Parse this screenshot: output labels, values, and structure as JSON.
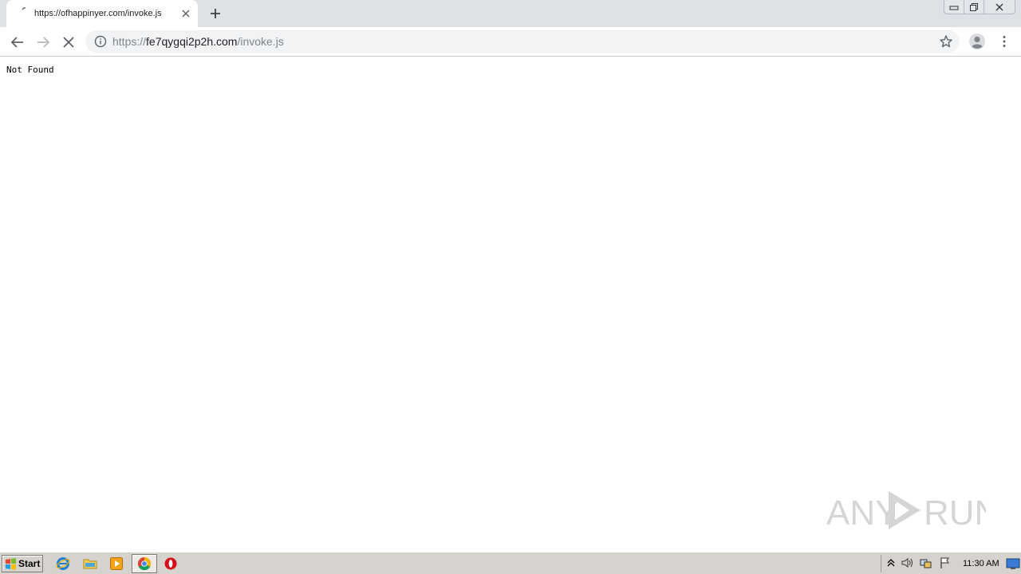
{
  "browser": {
    "tab": {
      "title": "https://ofhappinyer.com/invoke.js"
    },
    "address": {
      "scheme": "https://",
      "host": "fe7qygqi2p2h.com",
      "path": "/invoke.js"
    },
    "accent_color": "#1a73e8"
  },
  "page": {
    "body_text": "Not Found"
  },
  "watermark": {
    "text": "ANY RUN"
  },
  "taskbar": {
    "start_label": "Start",
    "clock": "11:30 AM",
    "quick_launch": [
      "ie-icon",
      "folder-icon",
      "media-player-icon",
      "chrome-icon",
      "opera-icon"
    ]
  }
}
